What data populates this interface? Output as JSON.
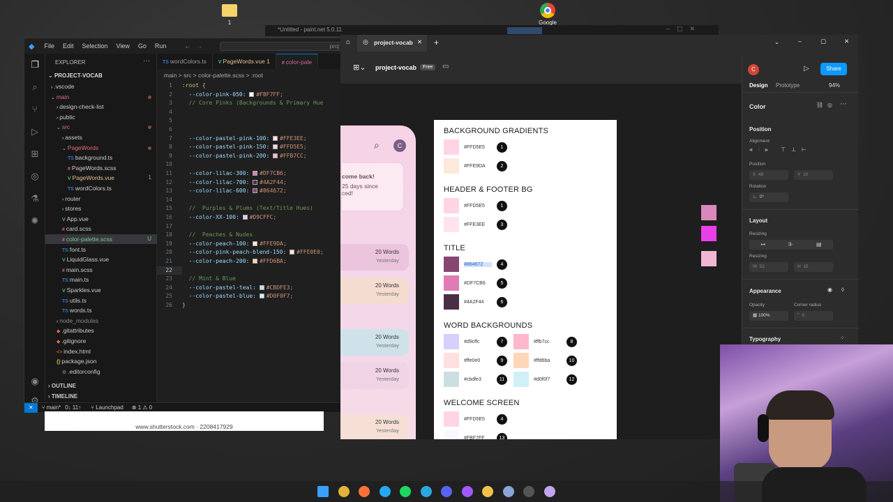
{
  "desktop": {
    "icons": [
      {
        "label": "1",
        "kind": "folder-icon",
        "color": "#f3d36a"
      },
      {
        "label": "Google",
        "kind": "chrome-icon",
        "color": "#4285f4"
      }
    ],
    "paint_title": "*Untitled - paint.net 5.0.11",
    "watermark": "www.shutterstock.com · 2208417929"
  },
  "vscode": {
    "menu": [
      "File",
      "Edit",
      "Selection",
      "View",
      "Go",
      "Run"
    ],
    "search_placeholder": "proj",
    "explorer_title": "EXPLORER",
    "project_title": "PROJECT-VOCAB",
    "tree": [
      {
        "label": ".vscode",
        "depth": 1,
        "type": "folder",
        "open": false
      },
      {
        "label": "main",
        "depth": 1,
        "type": "folder",
        "open": true,
        "color": "#e06c75",
        "dot": true
      },
      {
        "label": "design-check-list",
        "depth": 2,
        "type": "folder",
        "open": false
      },
      {
        "label": "public",
        "depth": 2,
        "type": "folder",
        "open": false
      },
      {
        "label": "src",
        "depth": 2,
        "type": "folder",
        "open": true,
        "color": "#e06c75",
        "dot": true
      },
      {
        "label": "assets",
        "depth": 3,
        "type": "folder",
        "open": false
      },
      {
        "label": "PageWords",
        "depth": 3,
        "type": "folder",
        "open": true,
        "color": "#e06c75",
        "dot": true
      },
      {
        "label": "background.ts",
        "depth": 4,
        "type": "ts"
      },
      {
        "label": "PageWords.scss",
        "depth": 4,
        "type": "scss"
      },
      {
        "label": "PageWords.vue",
        "depth": 4,
        "type": "vue",
        "color": "#e2c08d",
        "badge": "1"
      },
      {
        "label": "wordColors.ts",
        "depth": 4,
        "type": "ts"
      },
      {
        "label": "router",
        "depth": 3,
        "type": "folder",
        "open": false
      },
      {
        "label": "stores",
        "depth": 3,
        "type": "folder",
        "open": false
      },
      {
        "label": "App.vue",
        "depth": 3,
        "type": "vue"
      },
      {
        "label": "card.scss",
        "depth": 3,
        "type": "scss"
      },
      {
        "label": "color-palette.scss",
        "depth": 3,
        "type": "scss",
        "selected": true,
        "color": "#73c991",
        "badge": "U"
      },
      {
        "label": "font.ts",
        "depth": 3,
        "type": "ts"
      },
      {
        "label": "LiquidGlass.vue",
        "depth": 3,
        "type": "vue"
      },
      {
        "label": "main.scss",
        "depth": 3,
        "type": "scss"
      },
      {
        "label": "main.ts",
        "depth": 3,
        "type": "ts"
      },
      {
        "label": "Sparkles.vue",
        "depth": 3,
        "type": "vue"
      },
      {
        "label": "utils.ts",
        "depth": 3,
        "type": "ts"
      },
      {
        "label": "words.ts",
        "depth": 3,
        "type": "ts"
      },
      {
        "label": "node_modules",
        "depth": 2,
        "type": "folder",
        "open": false,
        "dim": true
      },
      {
        "label": ".gitattributes",
        "depth": 2,
        "type": "git"
      },
      {
        "label": ".gitignore",
        "depth": 2,
        "type": "git"
      },
      {
        "label": "index.html",
        "depth": 2,
        "type": "html"
      },
      {
        "label": "package.json",
        "depth": 2,
        "type": "json",
        "open": true
      },
      {
        "label": ".editorconfig",
        "depth": 3,
        "type": "cfg"
      }
    ],
    "outline": "OUTLINE",
    "timeline": "TIMELINE",
    "tabs": [
      {
        "label": "wordColors.ts",
        "prefix": "TS",
        "active": false
      },
      {
        "label": "PageWords.vue 1",
        "prefix": "V",
        "active": false
      },
      {
        "label": "color-pale",
        "prefix": "#",
        "active": true
      }
    ],
    "breadcrumb": "main > src > color-palette.scss > :root",
    "code": [
      {
        "n": "1",
        "parts": [
          {
            "t": ":root {",
            "c": "sel-txt"
          }
        ]
      },
      {
        "n": "2",
        "parts": [
          {
            "t": "  --color-pink-050: ",
            "c": "prop"
          },
          {
            "sw": "#FBF7FF"
          },
          {
            "t": "#FBF7FF;",
            "c": "val"
          }
        ]
      },
      {
        "n": "3",
        "parts": [
          {
            "t": "  // Core Pinks (Backgrounds & Primary Hue",
            "c": "cmt"
          }
        ]
      },
      {
        "n": "4",
        "parts": []
      },
      {
        "n": "5",
        "parts": []
      },
      {
        "n": "6",
        "parts": []
      },
      {
        "n": "7",
        "parts": [
          {
            "t": "  --color-pastel-pink-100: ",
            "c": "prop"
          },
          {
            "sw": "#FFE3EE"
          },
          {
            "t": "#FFE3EE;",
            "c": "val"
          }
        ]
      },
      {
        "n": "8",
        "parts": [
          {
            "t": "  --color-pastel-pink-150: ",
            "c": "prop"
          },
          {
            "sw": "#FFD5E5"
          },
          {
            "t": "#FFD5E5;",
            "c": "val"
          }
        ]
      },
      {
        "n": "9",
        "parts": [
          {
            "t": "  --color-pastel-pink-200: ",
            "c": "prop"
          },
          {
            "sw": "#FFB7CC"
          },
          {
            "t": "#FFB7CC;",
            "c": "val"
          }
        ]
      },
      {
        "n": "10",
        "parts": []
      },
      {
        "n": "11",
        "parts": [
          {
            "t": "  --color-lilac-300: ",
            "c": "prop"
          },
          {
            "sw": "#DF7CB6"
          },
          {
            "t": "#DF7CB6;",
            "c": "val"
          }
        ]
      },
      {
        "n": "12",
        "parts": [
          {
            "t": "  --color-lilac-700: ",
            "c": "prop"
          },
          {
            "sw": "#4A2F44"
          },
          {
            "t": "#4A2F44;",
            "c": "val"
          }
        ]
      },
      {
        "n": "13",
        "parts": [
          {
            "t": "  --color-lilac-600: ",
            "c": "prop"
          },
          {
            "sw": "#864672"
          },
          {
            "t": "#864672;",
            "c": "val"
          }
        ]
      },
      {
        "n": "14",
        "parts": []
      },
      {
        "n": "15",
        "parts": [
          {
            "t": "  //  Purples & Plums (Text/Title Hues)",
            "c": "cmt"
          }
        ]
      },
      {
        "n": "16",
        "parts": [
          {
            "t": "  --color-XX-100: ",
            "c": "prop"
          },
          {
            "sw": "#D9CFFC"
          },
          {
            "t": "#D9CFFC;",
            "c": "val"
          }
        ]
      },
      {
        "n": "17",
        "parts": []
      },
      {
        "n": "18",
        "parts": [
          {
            "t": "  //  Peaches & Nudes",
            "c": "cmt"
          }
        ]
      },
      {
        "n": "19",
        "parts": [
          {
            "t": "  --color-peach-100: ",
            "c": "prop"
          },
          {
            "sw": "#FFE9DA"
          },
          {
            "t": "#FFE9DA;",
            "c": "val"
          }
        ]
      },
      {
        "n": "20",
        "parts": [
          {
            "t": "  --color-pink-peach-blend-150: ",
            "c": "prop"
          },
          {
            "sw": "#FFE0E0"
          },
          {
            "t": "#FFE0E0;",
            "c": "val"
          }
        ]
      },
      {
        "n": "21",
        "parts": [
          {
            "t": "  --color-peach-200: ",
            "c": "prop"
          },
          {
            "sw": "#FFD6BA"
          },
          {
            "t": "#FFD6BA;",
            "c": "val"
          }
        ]
      },
      {
        "n": "22",
        "parts": [],
        "cur": true
      },
      {
        "n": "23",
        "parts": [
          {
            "t": "  // Mint & Blue",
            "c": "cmt"
          }
        ]
      },
      {
        "n": "24",
        "parts": [
          {
            "t": "  --color-pastel-teal: ",
            "c": "prop"
          },
          {
            "sw": "#CBDFE3"
          },
          {
            "t": "#CBDFE3;",
            "c": "val"
          }
        ]
      },
      {
        "n": "25",
        "parts": [
          {
            "t": "  --color-pastel-blue: ",
            "c": "prop"
          },
          {
            "sw": "#D0F0F7"
          },
          {
            "t": "#D0F0F7;",
            "c": "val"
          }
        ]
      },
      {
        "n": "26",
        "parts": [
          {
            "t": "}",
            "c": "sel-txt"
          }
        ]
      }
    ],
    "status": {
      "branch": "main*",
      "sync": "0↓ 11↑",
      "launchpad": "Launchpad",
      "problems": "⊗ 1 ⚠ 0"
    }
  },
  "figma": {
    "tab_label": "project-vocab",
    "file_name": "project-vocab",
    "plan_badge": "Free",
    "share_label": "Share",
    "mode_tabs": [
      "Design",
      "Prototype"
    ],
    "zoom": "94%",
    "phone": {
      "avatar_letter": "C",
      "welcome_title": "come back!",
      "welcome_line1": "25 days since",
      "welcome_line2": "ced!",
      "cards": [
        {
          "title": "20 Words",
          "sub": "Yesterday",
          "color": "#ecc4dd"
        },
        {
          "title": "20 Words",
          "sub": "Yesterday",
          "color": "#f4dcd0"
        },
        {
          "title": "20 Words",
          "sub": "Yesterday",
          "color": "#cfe2ea"
        },
        {
          "title": "20 Words",
          "sub": "Yesterday",
          "color": "#f0d4e6"
        },
        {
          "title": "20 Words",
          "sub": "Yesterday",
          "color": "#f6e0d6"
        }
      ]
    },
    "palette": {
      "sections": [
        {
          "title": "BACKGROUND GRADIENTS",
          "rows": [
            {
              "hex": "#FFD5E5",
              "num": "1",
              "color": "#FFD5E5"
            },
            {
              "hex": "#FFE9DA",
              "num": "2",
              "color": "#FFE9DA"
            }
          ]
        },
        {
          "title": "HEADER & FOOTER BG",
          "rows": [
            {
              "hex": "#FFD5E5",
              "num": "1",
              "color": "#FFD5E5"
            },
            {
              "hex": "#FFE3EE",
              "num": "3",
              "color": "#FFE3EE"
            }
          ]
        },
        {
          "title": "TITLE",
          "rows": [
            {
              "hex": "#864672",
              "num": "4",
              "color": "#864672",
              "highlight": true
            },
            {
              "hex": "#DF7CB6",
              "num": "5",
              "color": "#DF7CB6"
            },
            {
              "hex": "#4A2F44",
              "num": "6",
              "color": "#4A2F44"
            }
          ]
        },
        {
          "title": "WORD BACKGROUNDS",
          "rows": [
            {
              "hex": "#d9cffc",
              "num": "7",
              "color": "#d9cffc"
            },
            {
              "hex": "#ffb7cc",
              "num": "8",
              "color": "#ffb7cc"
            },
            {
              "hex": "#ffe0e0",
              "num": "9",
              "color": "#ffe0e0"
            },
            {
              "hex": "#ffd6ba",
              "num": "10",
              "color": "#ffd6ba"
            },
            {
              "hex": "#cbdfe3",
              "num": "11",
              "color": "#cbdfe3"
            },
            {
              "hex": "#d0f0f7",
              "num": "12",
              "color": "#d0f0f7"
            }
          ]
        },
        {
          "title": "WELCOME SCREEN",
          "rows": [
            {
              "hex": "#FFD5E5",
              "num": "4",
              "color": "#FFD5E5"
            },
            {
              "hex": "#FBF7FF",
              "num": "13",
              "color": "#FBF7FF"
            }
          ]
        }
      ]
    },
    "floating_swatches": [
      "#d987bd",
      "#e93fe8",
      "#f0b7d4"
    ],
    "right_panel": {
      "color_label": "Color",
      "position_label": "Position",
      "alignment_label": "Alignment",
      "position_sub": "Position",
      "x_value": "48",
      "y_value": "10",
      "rotation_label": "Rotation",
      "rotation_value": "0°",
      "layout_label": "Layout",
      "resizing_label": "Resizing",
      "w_value": "52",
      "h_value": "15",
      "appearance_label": "Appearance",
      "opacity_label": "Opacity",
      "opacity_value": "100%",
      "corner_label": "Corner radius",
      "corner_value": "0",
      "typography_label": "Typography"
    }
  },
  "taskbar": {
    "icons": [
      {
        "name": "windows-start-icon",
        "color": "#3aa0ff"
      },
      {
        "name": "chrome-taskbar-icon",
        "color": "#e2b33b"
      },
      {
        "name": "firefox-taskbar-icon",
        "color": "#ff7139"
      },
      {
        "name": "vscode-taskbar-icon",
        "color": "#23a9f2"
      },
      {
        "name": "spotify-taskbar-icon",
        "color": "#1ed760"
      },
      {
        "name": "edge-taskbar-icon",
        "color": "#2fa5e0"
      },
      {
        "name": "discord-taskbar-icon",
        "color": "#5865f2"
      },
      {
        "name": "figma-taskbar-icon",
        "color": "#a259ff"
      },
      {
        "name": "explorer-taskbar-icon",
        "color": "#f3c24a"
      },
      {
        "name": "paintnet-taskbar-icon",
        "color": "#8aa5d6"
      },
      {
        "name": "terminal-taskbar-icon",
        "color": "#555555"
      },
      {
        "name": "github-taskbar-icon",
        "color": "#c2a4f0"
      }
    ]
  }
}
